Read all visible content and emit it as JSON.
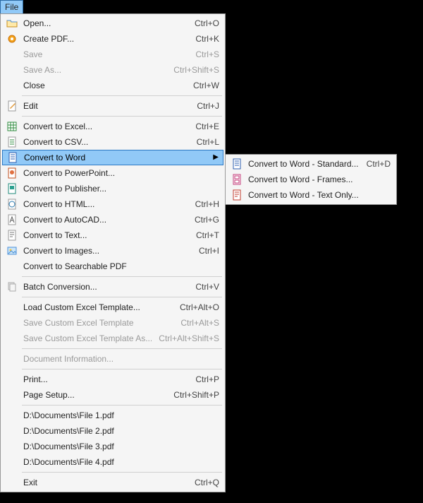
{
  "menubar": {
    "file_label": "File"
  },
  "menu": {
    "open": "Open...",
    "create_pdf": "Create PDF...",
    "save": "Save",
    "save_as": "Save As...",
    "close": "Close",
    "edit": "Edit",
    "convert_excel": "Convert to Excel...",
    "convert_csv": "Convert to CSV...",
    "convert_word": "Convert to Word",
    "convert_powerpoint": "Convert to PowerPoint...",
    "convert_publisher": "Convert to Publisher...",
    "convert_html": "Convert to HTML...",
    "convert_autocad": "Convert to AutoCAD...",
    "convert_text": "Convert to Text...",
    "convert_images": "Convert to Images...",
    "convert_searchable": "Convert to Searchable PDF",
    "batch": "Batch Conversion...",
    "load_template": "Load Custom Excel Template...",
    "save_template": "Save Custom Excel Template",
    "save_template_as": "Save Custom Excel Template As...",
    "doc_info": "Document Information...",
    "print": "Print...",
    "page_setup": "Page Setup...",
    "recent1": "D:\\Documents\\File 1.pdf",
    "recent2": "D:\\Documents\\File 2.pdf",
    "recent3": "D:\\Documents\\File 3.pdf",
    "recent4": "D:\\Documents\\File 4.pdf",
    "exit": "Exit"
  },
  "shortcuts": {
    "open": "Ctrl+O",
    "create_pdf": "Ctrl+K",
    "save": "Ctrl+S",
    "save_as": "Ctrl+Shift+S",
    "close": "Ctrl+W",
    "edit": "Ctrl+J",
    "convert_excel": "Ctrl+E",
    "convert_csv": "Ctrl+L",
    "convert_html": "Ctrl+H",
    "convert_autocad": "Ctrl+G",
    "convert_text": "Ctrl+T",
    "convert_images": "Ctrl+I",
    "batch": "Ctrl+V",
    "load_template": "Ctrl+Alt+O",
    "save_template": "Ctrl+Alt+S",
    "save_template_as": "Ctrl+Alt+Shift+S",
    "print": "Ctrl+P",
    "page_setup": "Ctrl+Shift+P",
    "exit": "Ctrl+Q",
    "word_standard": "Ctrl+D"
  },
  "submenu": {
    "standard": "Convert to Word - Standard...",
    "frames": "Convert to Word - Frames...",
    "text_only": "Convert to Word - Text Only..."
  }
}
